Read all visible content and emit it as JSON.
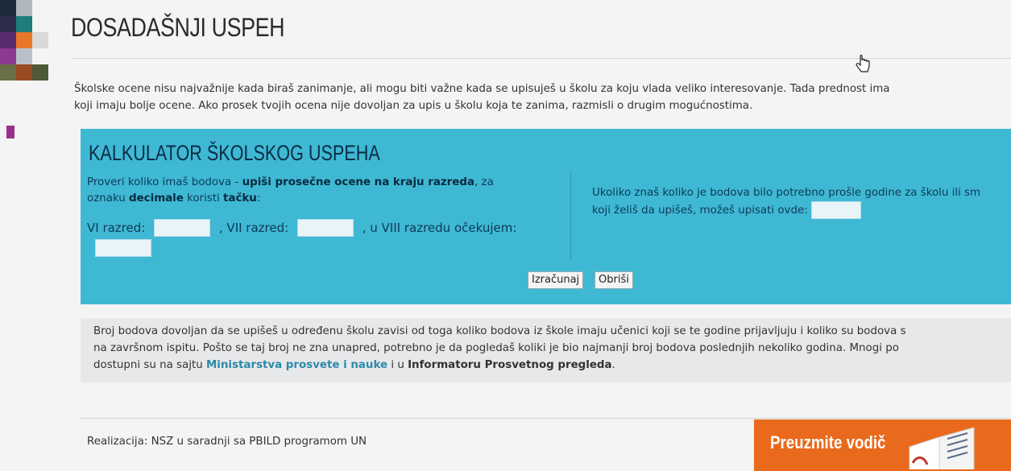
{
  "page": {
    "title": "DOSADAŠNJI USPEH",
    "intro": [
      "Školske ocene nisu najvažnije kada biraš zanimanje, ali mogu biti važne kada se upisuješ u školu za koju vlada veliko interesovanje. Tada prednost ima",
      "koji imaju bolje ocene. Ako prosek tvojih ocena nije dovoljan za upis u školu koja te zanima, razmisli o drugim mogućnostima."
    ]
  },
  "calculator": {
    "title": "KALKULATOR ŠKOLSKOG USPEHA",
    "instr_1": "Proveri koliko imaš bodova - ",
    "instr_bold_1": "upiši prosečne ocene na kraju razreda",
    "instr_2": ", za",
    "instr_3": "oznaku ",
    "instr_bold_2": "decimale",
    "instr_4": " koristi ",
    "instr_bold_3": "tačku",
    "instr_5": ":",
    "label_vi": "VI razred:",
    "label_vii": ", VII razred:",
    "label_viii": ", u VIII razredu očekujem:",
    "right_line_1": "Ukoliko znaš koliko je bodova bilo potrebno prošle godine za školu ili sm",
    "right_line_2": "koji želiš da upišeš, možeš upisati ovde:",
    "inputs": {
      "vi": "",
      "vii": "",
      "viii": "",
      "previous_points": ""
    },
    "calc_button": "Izračunaj",
    "clear_button": "Obriši"
  },
  "info": {
    "line_1": "Broj bodova dovoljan da se upišeš u određenu školu zavisi od toga koliko bodova iz škole imaju učenici koji se te godine prijavljuju i koliko su bodova s",
    "line_2": "na završnom ispitu. Pošto se taj broj ne zna unapred, potrebno je da pogledaš koliki je bio najmanji broj bodova poslednjih nekoliko godina. Mnogi po",
    "line_3_pre": "dostupni su na sajtu ",
    "link_ministry": "Ministarstva prosvete i nauke",
    "line_3_mid": " i u ",
    "link_informator": "Informatoru Prosvetnog pregleda",
    "line_3_post": "."
  },
  "footer": {
    "credit": "Realizacija: NSZ u saradnji sa PBILD programom UN",
    "banner_label": "Preuzmite vodič"
  },
  "colors": {
    "calculator_bg": "#3fb8d4",
    "banner_bg": "#e96a1c",
    "link": "#2c8aaa"
  }
}
